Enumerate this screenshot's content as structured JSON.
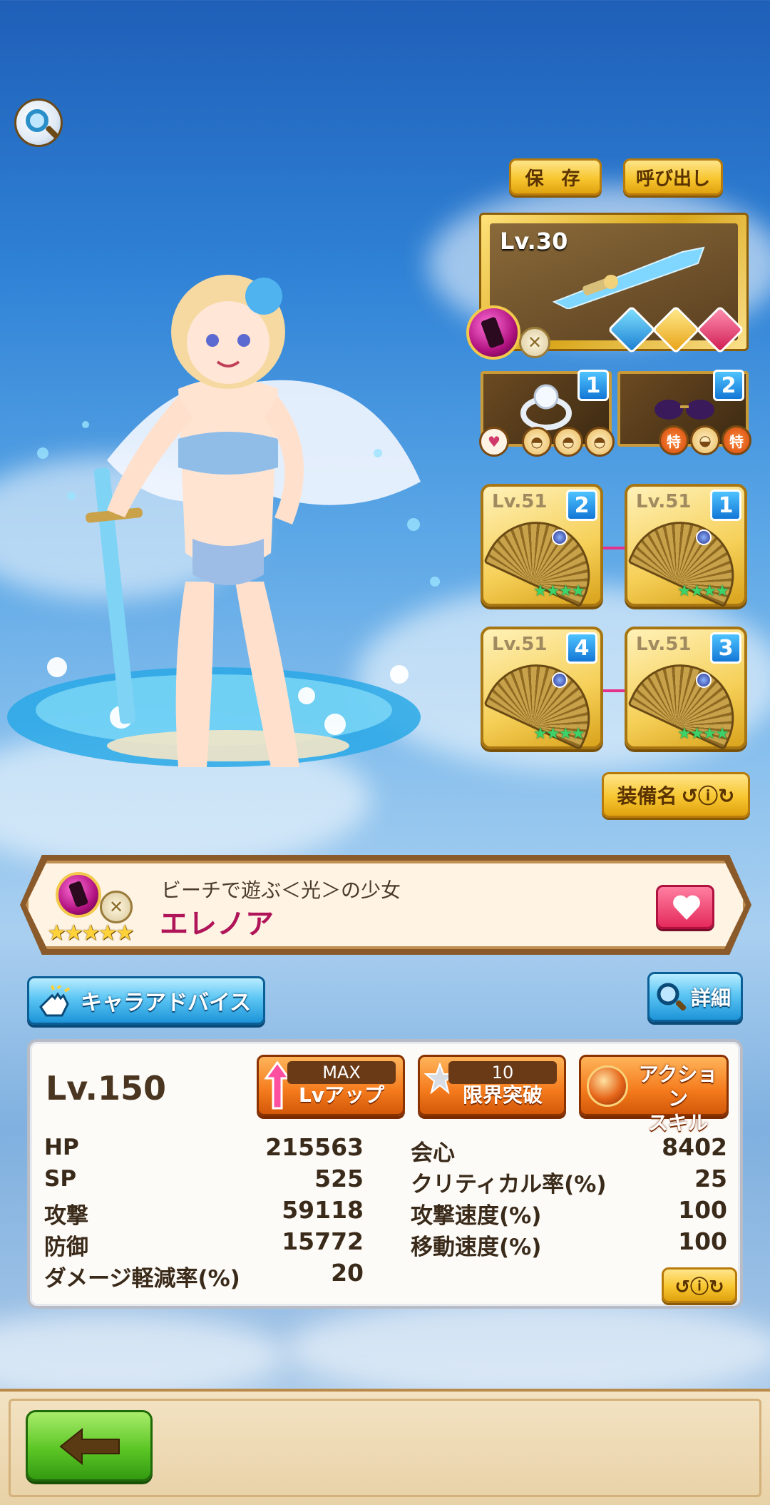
{
  "header": {
    "save_label": "保 存",
    "call_label": "呼び出し"
  },
  "weapon": {
    "level": "Lv.30"
  },
  "accessories": [
    {
      "slot": "1"
    },
    {
      "slot": "2",
      "badges": [
        "特",
        "特"
      ]
    }
  ],
  "equipment": [
    {
      "level": "Lv.51",
      "slot": "2",
      "stars": "★★★★"
    },
    {
      "level": "Lv.51",
      "slot": "1",
      "stars": "★★★★"
    },
    {
      "level": "Lv.51",
      "slot": "4",
      "stars": "★★★★"
    },
    {
      "level": "Lv.51",
      "slot": "3",
      "stars": "★★★★"
    }
  ],
  "equip_name_label": "装備名",
  "character": {
    "subtitle": "ビーチで遊ぶ＜光＞の少女",
    "name": "エレノア",
    "rarity": "★★★★★"
  },
  "advice_label": "キャラアドバイス",
  "detail_label": "詳細",
  "stats_panel": {
    "level": "Lv.150",
    "lvup_top": "MAX",
    "lvup_label": "Lvアップ",
    "limit_top": "10",
    "limit_label": "限界突破",
    "action_label_1": "アクション",
    "action_label_2": "スキル",
    "left_stats": [
      {
        "label": "HP",
        "value": "215563"
      },
      {
        "label": "SP",
        "value": "525"
      },
      {
        "label": "攻撃",
        "value": "59118"
      },
      {
        "label": "防御",
        "value": "15772"
      },
      {
        "label": "ダメージ軽減率(%)",
        "value": "20"
      }
    ],
    "right_stats": [
      {
        "label": "会心",
        "value": "8402"
      },
      {
        "label": "クリティカル率(%)",
        "value": "25"
      },
      {
        "label": "攻撃速度(%)",
        "value": "100"
      },
      {
        "label": "移動速度(%)",
        "value": "100"
      }
    ]
  },
  "colors": {
    "gold": "#f7c630",
    "element_orb": "#b0127f",
    "name": "#b0155a",
    "equip_badge": "#1377d6"
  },
  "icons": [
    "magnifier-icon",
    "sword-icon",
    "ring-icon",
    "glasses-icon",
    "fan-icon",
    "heart-icon",
    "hand-pointer-icon",
    "search-icon",
    "arrow-up-icon",
    "star-icon",
    "info-icon",
    "back-arrow-icon"
  ]
}
